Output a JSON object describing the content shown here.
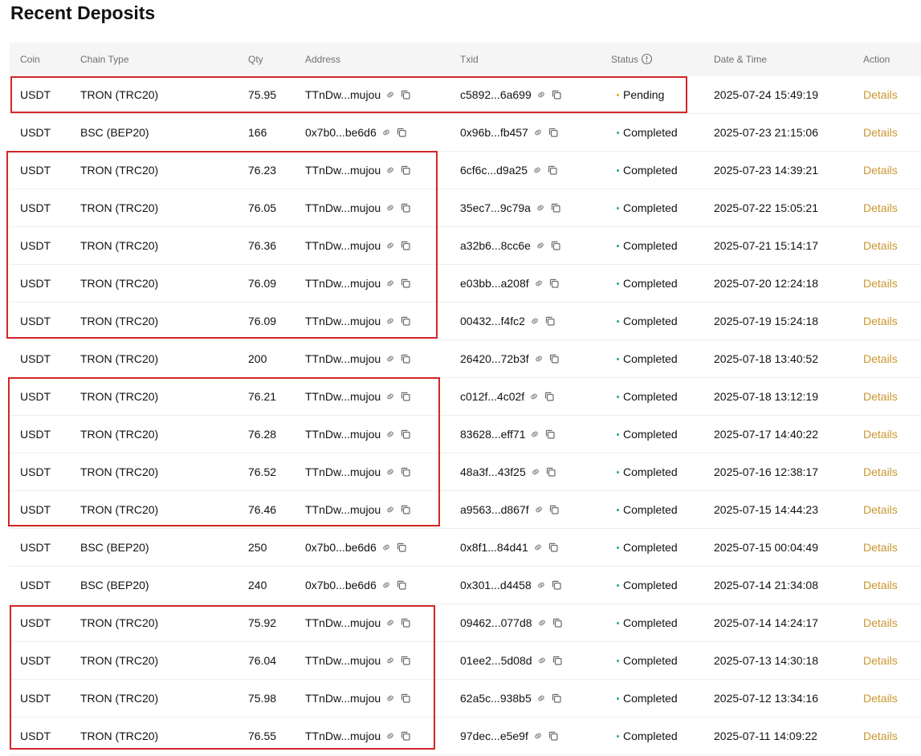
{
  "page": {
    "title": "Recent Deposits"
  },
  "table": {
    "columns": {
      "coin": "Coin",
      "chain": "Chain Type",
      "qty": "Qty",
      "address": "Address",
      "txid": "Txid",
      "status": "Status",
      "date": "Date & Time",
      "action": "Action"
    },
    "rows": [
      {
        "coin": "USDT",
        "chain": "TRON (TRC20)",
        "qty": "75.95",
        "address": "TTnDw...mujou",
        "txid": "c5892...6a699",
        "status": "Pending",
        "date": "2025-07-24 15:49:19",
        "action": "Details"
      },
      {
        "coin": "USDT",
        "chain": "BSC (BEP20)",
        "qty": "166",
        "address": "0x7b0...be6d6",
        "txid": "0x96b...fb457",
        "status": "Completed",
        "date": "2025-07-23 21:15:06",
        "action": "Details"
      },
      {
        "coin": "USDT",
        "chain": "TRON (TRC20)",
        "qty": "76.23",
        "address": "TTnDw...mujou",
        "txid": "6cf6c...d9a25",
        "status": "Completed",
        "date": "2025-07-23 14:39:21",
        "action": "Details"
      },
      {
        "coin": "USDT",
        "chain": "TRON (TRC20)",
        "qty": "76.05",
        "address": "TTnDw...mujou",
        "txid": "35ec7...9c79a",
        "status": "Completed",
        "date": "2025-07-22 15:05:21",
        "action": "Details"
      },
      {
        "coin": "USDT",
        "chain": "TRON (TRC20)",
        "qty": "76.36",
        "address": "TTnDw...mujou",
        "txid": "a32b6...8cc6e",
        "status": "Completed",
        "date": "2025-07-21 15:14:17",
        "action": "Details"
      },
      {
        "coin": "USDT",
        "chain": "TRON (TRC20)",
        "qty": "76.09",
        "address": "TTnDw...mujou",
        "txid": "e03bb...a208f",
        "status": "Completed",
        "date": "2025-07-20 12:24:18",
        "action": "Details"
      },
      {
        "coin": "USDT",
        "chain": "TRON (TRC20)",
        "qty": "76.09",
        "address": "TTnDw...mujou",
        "txid": "00432...f4fc2",
        "status": "Completed",
        "date": "2025-07-19 15:24:18",
        "action": "Details"
      },
      {
        "coin": "USDT",
        "chain": "TRON (TRC20)",
        "qty": "200",
        "address": "TTnDw...mujou",
        "txid": "26420...72b3f",
        "status": "Completed",
        "date": "2025-07-18 13:40:52",
        "action": "Details"
      },
      {
        "coin": "USDT",
        "chain": "TRON (TRC20)",
        "qty": "76.21",
        "address": "TTnDw...mujou",
        "txid": "c012f...4c02f",
        "status": "Completed",
        "date": "2025-07-18 13:12:19",
        "action": "Details"
      },
      {
        "coin": "USDT",
        "chain": "TRON (TRC20)",
        "qty": "76.28",
        "address": "TTnDw...mujou",
        "txid": "83628...eff71",
        "status": "Completed",
        "date": "2025-07-17 14:40:22",
        "action": "Details"
      },
      {
        "coin": "USDT",
        "chain": "TRON (TRC20)",
        "qty": "76.52",
        "address": "TTnDw...mujou",
        "txid": "48a3f...43f25",
        "status": "Completed",
        "date": "2025-07-16 12:38:17",
        "action": "Details"
      },
      {
        "coin": "USDT",
        "chain": "TRON (TRC20)",
        "qty": "76.46",
        "address": "TTnDw...mujou",
        "txid": "a9563...d867f",
        "status": "Completed",
        "date": "2025-07-15 14:44:23",
        "action": "Details"
      },
      {
        "coin": "USDT",
        "chain": "BSC (BEP20)",
        "qty": "250",
        "address": "0x7b0...be6d6",
        "txid": "0x8f1...84d41",
        "status": "Completed",
        "date": "2025-07-15 00:04:49",
        "action": "Details"
      },
      {
        "coin": "USDT",
        "chain": "BSC (BEP20)",
        "qty": "240",
        "address": "0x7b0...be6d6",
        "txid": "0x301...d4458",
        "status": "Completed",
        "date": "2025-07-14 21:34:08",
        "action": "Details"
      },
      {
        "coin": "USDT",
        "chain": "TRON (TRC20)",
        "qty": "75.92",
        "address": "TTnDw...mujou",
        "txid": "09462...077d8",
        "status": "Completed",
        "date": "2025-07-14 14:24:17",
        "action": "Details"
      },
      {
        "coin": "USDT",
        "chain": "TRON (TRC20)",
        "qty": "76.04",
        "address": "TTnDw...mujou",
        "txid": "01ee2...5d08d",
        "status": "Completed",
        "date": "2025-07-13 14:30:18",
        "action": "Details"
      },
      {
        "coin": "USDT",
        "chain": "TRON (TRC20)",
        "qty": "75.98",
        "address": "TTnDw...mujou",
        "txid": "62a5c...938b5",
        "status": "Completed",
        "date": "2025-07-12 13:34:16",
        "action": "Details"
      },
      {
        "coin": "USDT",
        "chain": "TRON (TRC20)",
        "qty": "76.55",
        "address": "TTnDw...mujou",
        "txid": "97dec...e5e9f",
        "status": "Completed",
        "date": "2025-07-11 14:09:22",
        "action": "Details"
      }
    ]
  },
  "icons": {
    "link": "link-icon",
    "copy": "copy-icon",
    "info": "info-icon"
  },
  "colors": {
    "accent": "#c9962e",
    "completed_dot": "#20b26c",
    "pending_dot": "#f0a020",
    "highlight_border": "#d42626",
    "header_bg": "#f5f5f5"
  }
}
